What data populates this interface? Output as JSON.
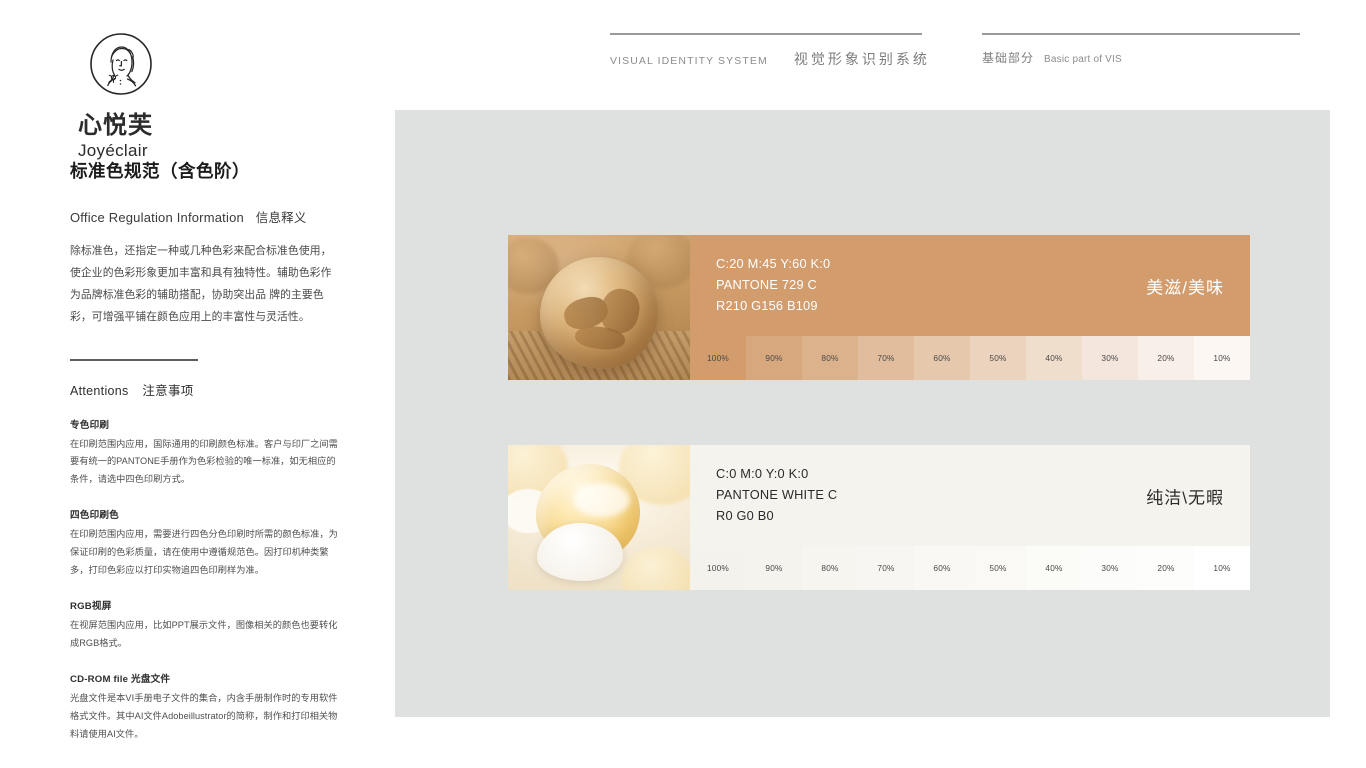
{
  "header": {
    "left": {
      "en": "VISUAL  IDENTITY  SYSTEM",
      "cn": "视觉形象识别系统"
    },
    "right": {
      "cn": "基础部分",
      "en": "Basic part of VIS"
    }
  },
  "logo": {
    "cn": "心悦芙",
    "en": "Joyéclair",
    "mark": "woman-portrait-logo-icon"
  },
  "sidebar": {
    "title": "标准色规范（含色阶）",
    "subtitle_en": "Office Regulation Information",
    "subtitle_cn": "信息释义",
    "body": "除标准色，还指定一种或几种色彩来配合标准色使用，使企业的色彩形象更加丰富和具有独特性。辅助色彩作为品牌标准色彩的辅助搭配，协助突出品 牌的主要色彩，可增强平铺在颜色应用上的丰富性与灵活性。",
    "attentions_en": "Attentions",
    "attentions_cn": "注意事项",
    "notes": [
      {
        "heading": "专色印刷",
        "body": "在印刷范围内应用，国际通用的印刷颜色标准。客户与印厂之间需要有统一的PANTONE手册作为色彩检验的唯一标准，如无相应的条件，请选中四色印刷方式。"
      },
      {
        "heading": "四色印刷色",
        "body": "在印刷范围内应用，需要进行四色分色印刷时所需的颜色标准，为保证印刷的色彩质量，请在使用中遵循规范色。因打印机种类繁多，打印色彩应以打印实物追四色印刷样为准。"
      },
      {
        "heading": "RGB视屏",
        "body": "在视屏范围内应用，比如PPT展示文件，图像相关的颜色也要转化成RGB格式。"
      },
      {
        "heading": "CD-ROM file  光盘文件",
        "body": "光盘文件是本VI手册电子文件的集合，内含手册制作时的专用软件格式文件。其中AI文件Adobeillustrator的简称，制作和打印相关物料请使用AI文件。"
      }
    ]
  },
  "swatches": [
    {
      "photo_name": "choux-pastry-photo",
      "cmyk": "C:20 M:45 Y:60 K:0",
      "pantone": "PANTONE 729 C",
      "rgb": "R210 G156 B109",
      "name_cn": "美滋/美味",
      "base_hex": "#d29c6d",
      "text_color": "#ffffff",
      "tints": [
        {
          "label": "100%",
          "hex": "#d29c6d"
        },
        {
          "label": "90%",
          "hex": "#d7a77d"
        },
        {
          "label": "80%",
          "hex": "#dcb28d"
        },
        {
          "label": "70%",
          "hex": "#e1bd9d"
        },
        {
          "label": "60%",
          "hex": "#e6c8ad"
        },
        {
          "label": "50%",
          "hex": "#ebd3bd"
        },
        {
          "label": "40%",
          "hex": "#f0decd"
        },
        {
          "label": "30%",
          "hex": "#f4e6dc"
        },
        {
          "label": "20%",
          "hex": "#f8efe8"
        },
        {
          "label": "10%",
          "hex": "#fcf7f3"
        }
      ]
    },
    {
      "photo_name": "cream-puff-photo",
      "cmyk": "C:0 M:0 Y:0 K:0",
      "pantone": "PANTONE WHITE C",
      "rgb": "R0 G0 B0",
      "name_cn": "纯洁\\无暇",
      "base_hex": "#f5f3ed",
      "text_color": "#2b2b2b",
      "tints": [
        {
          "label": "100%",
          "hex": "#f4f2ec"
        },
        {
          "label": "90%",
          "hex": "#f5f3ee"
        },
        {
          "label": "80%",
          "hex": "#f6f5f0"
        },
        {
          "label": "70%",
          "hex": "#f8f6f2"
        },
        {
          "label": "60%",
          "hex": "#f9f8f4"
        },
        {
          "label": "50%",
          "hex": "#faf9f6"
        },
        {
          "label": "40%",
          "hex": "#fbfbf8"
        },
        {
          "label": "30%",
          "hex": "#fcfcfa"
        },
        {
          "label": "20%",
          "hex": "#fdfdfc"
        },
        {
          "label": "10%",
          "hex": "#ffffff"
        }
      ]
    }
  ]
}
